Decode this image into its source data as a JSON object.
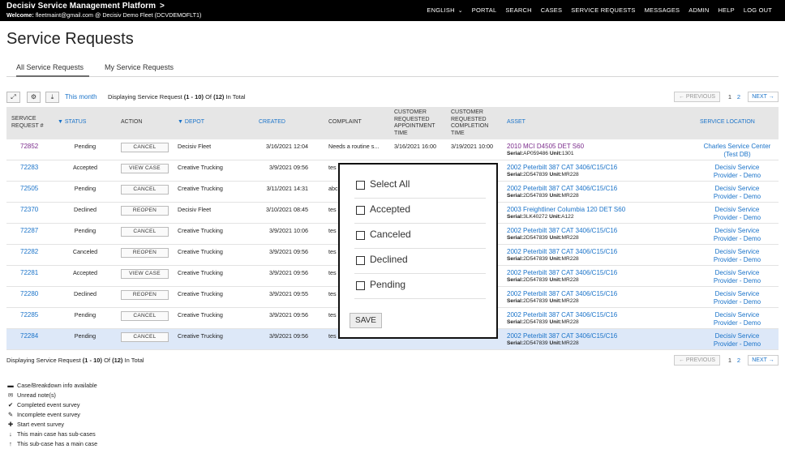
{
  "header": {
    "brand": "Decisiv Service Management Platform",
    "brand_chevron": ">",
    "welcome_label": "Welcome:",
    "welcome_text": "fleetmaint@gmail.com @ Decisiv Demo Fleet (DCVDEMOFLT1)",
    "nav": [
      "ENGLISH",
      "PORTAL",
      "SEARCH",
      "CASES",
      "SERVICE REQUESTS",
      "MESSAGES",
      "ADMIN",
      "HELP",
      "LOG OUT"
    ],
    "lang_caret": "⌄"
  },
  "page_title": "Service Requests",
  "tabs": [
    "All Service Requests",
    "My Service Requests"
  ],
  "toolbar": {
    "this_month": "This month",
    "displaying_prefix": "Displaying Service Request ",
    "displaying_range": "(1 - 10)",
    "displaying_of": " Of ",
    "displaying_total": "(12)",
    "displaying_suffix": " In Total"
  },
  "pager": {
    "previous": "← PREVIOUS",
    "page1": "1",
    "page2": "2",
    "next": "NEXT →"
  },
  "columns": {
    "sr_number": "SERVICE REQUEST #",
    "status": "STATUS",
    "action": "ACTION",
    "depot": "DEPOT",
    "created": "CREATED",
    "complaint": "COMPLAINT",
    "appt_time": "CUSTOMER REQUESTED APPOINTMENT TIME",
    "completion_time": "CUSTOMER REQUESTED COMPLETION TIME",
    "asset": "ASSET",
    "location": "SERVICE LOCATION"
  },
  "rows": [
    {
      "id": "72852",
      "status": "Pending",
      "action": "CANCEL",
      "depot": "Decisiv Fleet",
      "created": "3/16/2021 12:04",
      "complaint": "Needs a routine s...",
      "appt": "3/16/2021 16:00",
      "completion": "3/19/2021 10:00",
      "asset": "2010 MCI D4505 DET S60",
      "serial_label": "Serial:",
      "serial": "AP059486",
      "unit_label": "Unit:",
      "unit": "1301",
      "loc1": "Charles Service Center",
      "loc2": "(Test DB)"
    },
    {
      "id": "72283",
      "status": "Accepted",
      "action": "VIEW CASE",
      "depot": "Creative Trucking",
      "created": "3/9/2021 09:56",
      "complaint": "tes",
      "appt": "",
      "completion": "",
      "asset": "2002 Peterbilt 387 CAT 3406/C15/C16",
      "serial_label": "Serial:",
      "serial": "2D547839",
      "unit_label": "Unit:",
      "unit": "MR228",
      "loc1": "Decisiv Service",
      "loc2": "Provider - Demo"
    },
    {
      "id": "72505",
      "status": "Pending",
      "action": "CANCEL",
      "depot": "Creative Trucking",
      "created": "3/11/2021 14:31",
      "complaint": "abc",
      "appt": "",
      "completion": "",
      "asset": "2002 Peterbilt 387 CAT 3406/C15/C16",
      "serial_label": "Serial:",
      "serial": "2D547839",
      "unit_label": "Unit:",
      "unit": "MR228",
      "loc1": "Decisiv Service",
      "loc2": "Provider - Demo"
    },
    {
      "id": "72370",
      "status": "Declined",
      "action": "REOPEN",
      "depot": "Decisiv Fleet",
      "created": "3/10/2021 08:45",
      "complaint": "tes",
      "appt": "",
      "completion": "",
      "asset": "2003 Freightliner Columbia 120 DET S60",
      "serial_label": "Serial:",
      "serial": "3LK40272",
      "unit_label": "Unit:",
      "unit": "A122",
      "loc1": "Decisiv Service",
      "loc2": "Provider - Demo"
    },
    {
      "id": "72287",
      "status": "Pending",
      "action": "CANCEL",
      "depot": "Creative Trucking",
      "created": "3/9/2021 10:06",
      "complaint": "tes",
      "appt": "",
      "completion": "",
      "asset": "2002 Peterbilt 387 CAT 3406/C15/C16",
      "serial_label": "Serial:",
      "serial": "2D547839",
      "unit_label": "Unit:",
      "unit": "MR228",
      "loc1": "Decisiv Service",
      "loc2": "Provider - Demo"
    },
    {
      "id": "72282",
      "status": "Canceled",
      "action": "REOPEN",
      "depot": "Creative Trucking",
      "created": "3/9/2021 09:56",
      "complaint": "tes",
      "appt": "",
      "completion": "",
      "asset": "2002 Peterbilt 387 CAT 3406/C15/C16",
      "serial_label": "Serial:",
      "serial": "2D547839",
      "unit_label": "Unit:",
      "unit": "MR228",
      "loc1": "Decisiv Service",
      "loc2": "Provider - Demo"
    },
    {
      "id": "72281",
      "status": "Accepted",
      "action": "VIEW CASE",
      "depot": "Creative Trucking",
      "created": "3/9/2021 09:56",
      "complaint": "tes",
      "appt": "",
      "completion": "",
      "asset": "2002 Peterbilt 387 CAT 3406/C15/C16",
      "serial_label": "Serial:",
      "serial": "2D547839",
      "unit_label": "Unit:",
      "unit": "MR228",
      "loc1": "Decisiv Service",
      "loc2": "Provider - Demo"
    },
    {
      "id": "72280",
      "status": "Declined",
      "action": "REOPEN",
      "depot": "Creative Trucking",
      "created": "3/9/2021 09:55",
      "complaint": "tes",
      "appt": "",
      "completion": "",
      "asset": "2002 Peterbilt 387 CAT 3406/C15/C16",
      "serial_label": "Serial:",
      "serial": "2D547839",
      "unit_label": "Unit:",
      "unit": "MR228",
      "loc1": "Decisiv Service",
      "loc2": "Provider - Demo"
    },
    {
      "id": "72285",
      "status": "Pending",
      "action": "CANCEL",
      "depot": "Creative Trucking",
      "created": "3/9/2021 09:56",
      "complaint": "tes",
      "appt": "",
      "completion": "",
      "asset": "2002 Peterbilt 387 CAT 3406/C15/C16",
      "serial_label": "Serial:",
      "serial": "2D547839",
      "unit_label": "Unit:",
      "unit": "MR228",
      "loc1": "Decisiv Service",
      "loc2": "Provider - Demo"
    },
    {
      "id": "72284",
      "status": "Pending",
      "action": "CANCEL",
      "depot": "Creative Trucking",
      "created": "3/9/2021 09:56",
      "complaint": "tes",
      "appt": "",
      "completion": "",
      "asset": "2002 Peterbilt 387 CAT 3406/C15/C16",
      "serial_label": "Serial:",
      "serial": "2D547839",
      "unit_label": "Unit:",
      "unit": "MR228",
      "loc1": "Decisiv Service",
      "loc2": "Provider - Demo"
    }
  ],
  "legend": [
    {
      "icon": "briefcase-icon",
      "glyph": "▬",
      "text": "Case/Breakdown info available"
    },
    {
      "icon": "envelope-icon",
      "glyph": "✉",
      "text": "Unread note(s)"
    },
    {
      "icon": "check-circle-icon",
      "glyph": "✔",
      "text": "Completed event survey"
    },
    {
      "icon": "edit-icon",
      "glyph": "✎",
      "text": "Incomplete event survey"
    },
    {
      "icon": "plus-circle-icon",
      "glyph": "✚",
      "text": "Start event survey"
    },
    {
      "icon": "arrow-down-icon",
      "glyph": "↓",
      "text": "This main case has sub-cases"
    },
    {
      "icon": "arrow-up-icon",
      "glyph": "↑",
      "text": "This sub-case has a main case"
    }
  ],
  "status_filter": {
    "options": [
      "Select All",
      "Accepted",
      "Canceled",
      "Declined",
      "Pending"
    ],
    "save": "SAVE"
  },
  "colors": {
    "link": "#1a73c9",
    "highlight_link": "#7b2c8c",
    "topbar": "#000000",
    "selected_row": "#dde8f8"
  }
}
